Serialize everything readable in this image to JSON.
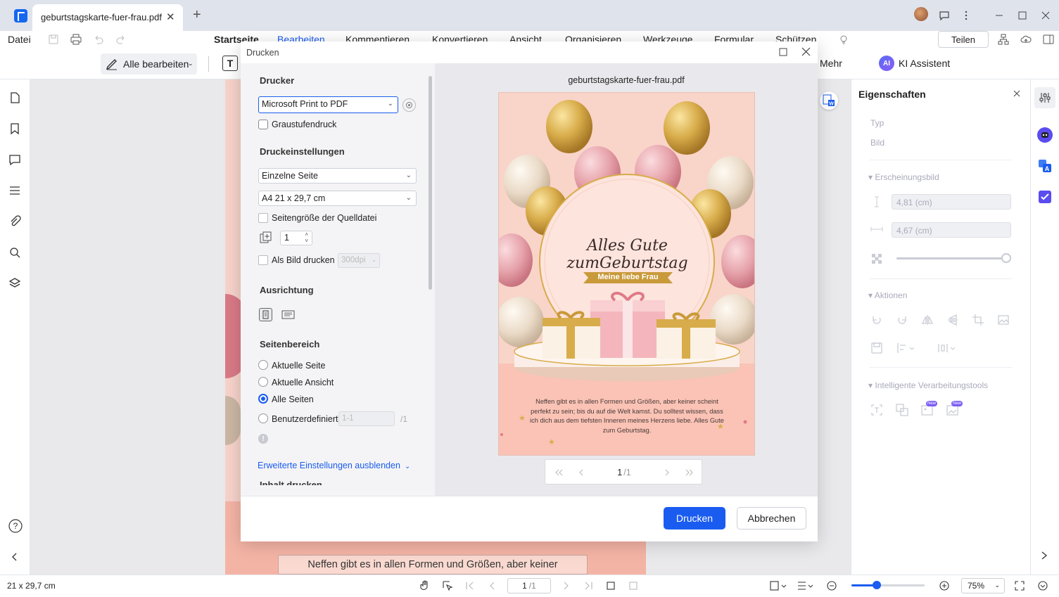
{
  "titlebar": {
    "tab_title": "geburtstagskarte-fuer-frau.pdf",
    "close": "✕",
    "new_tab": "+"
  },
  "menu": {
    "file": "Datei",
    "items": [
      "Startseite",
      "Bearbeiten",
      "Kommentieren",
      "Konvertieren",
      "Ansicht",
      "Organisieren",
      "Werkzeuge",
      "Formular",
      "Schützen"
    ],
    "share": "Teilen"
  },
  "toolbar": {
    "edit_all": "Alle bearbeiten",
    "more": "Mehr",
    "ai": "KI Assistent",
    "ai_badge": "AI"
  },
  "dialog": {
    "title": "Drucken",
    "printer_heading": "Drucker",
    "printer_value": "Microsoft Print to PDF",
    "grayscale": "Graustufendruck",
    "settings_heading": "Druckeinstellungen",
    "page_mode": "Einzelne Seite",
    "paper_size": "A4 21 x 29,7 cm",
    "source_size": "Seitengröße der Quelldatei",
    "copies": "1",
    "as_image": "Als Bild drucken",
    "dpi": "300dpi",
    "orientation_heading": "Ausrichtung",
    "range_heading": "Seitenbereich",
    "range_current_page": "Aktuelle Seite",
    "range_current_view": "Aktuelle Ansicht",
    "range_all": "Alle Seiten",
    "range_custom": "Benutzerdefiniert",
    "custom_placeholder": "1-1",
    "custom_total": "/1",
    "advanced_link": "Erweiterte Einstellungen ausblenden",
    "content_heading": "Inhalt drucken",
    "preview_filename": "geburtstagskarte-fuer-frau.pdf",
    "preview_page": "1",
    "preview_total": "/1",
    "print_button": "Drucken",
    "cancel_button": "Abbrechen"
  },
  "card": {
    "headline": "Alles Gute zumGeburtstag",
    "ribbon": "Meine liebe Frau",
    "body": "Neffen gibt es in allen Formen und Größen, aber keiner scheint perfekt zu sein; bis du auf die Welt kamst. Du solltest wissen, dass ich dich aus dem tiefsten Inneren meines Herzens liebe. Alles Gute zum Geburtstag.",
    "bg_text": "Neffen gibt es in allen Formen und Größen, aber keiner"
  },
  "properties": {
    "title": "Eigenschaften",
    "type_label": "Typ",
    "type_value": "Bild",
    "appearance": "Erscheinungsbild",
    "height": "4,81 (cm)",
    "width": "4,67 (cm)",
    "actions": "Aktionen",
    "smart_tools": "Intelligente Verarbeitungstools",
    "new_badge": "New"
  },
  "status": {
    "page_size": "21 x 29,7 cm",
    "page": "1",
    "total": "/1",
    "zoom": "75%"
  },
  "colors": {
    "accent": "#1a5cf0",
    "card_pink": "#f8c8bd",
    "gold": "#c99a3a"
  }
}
